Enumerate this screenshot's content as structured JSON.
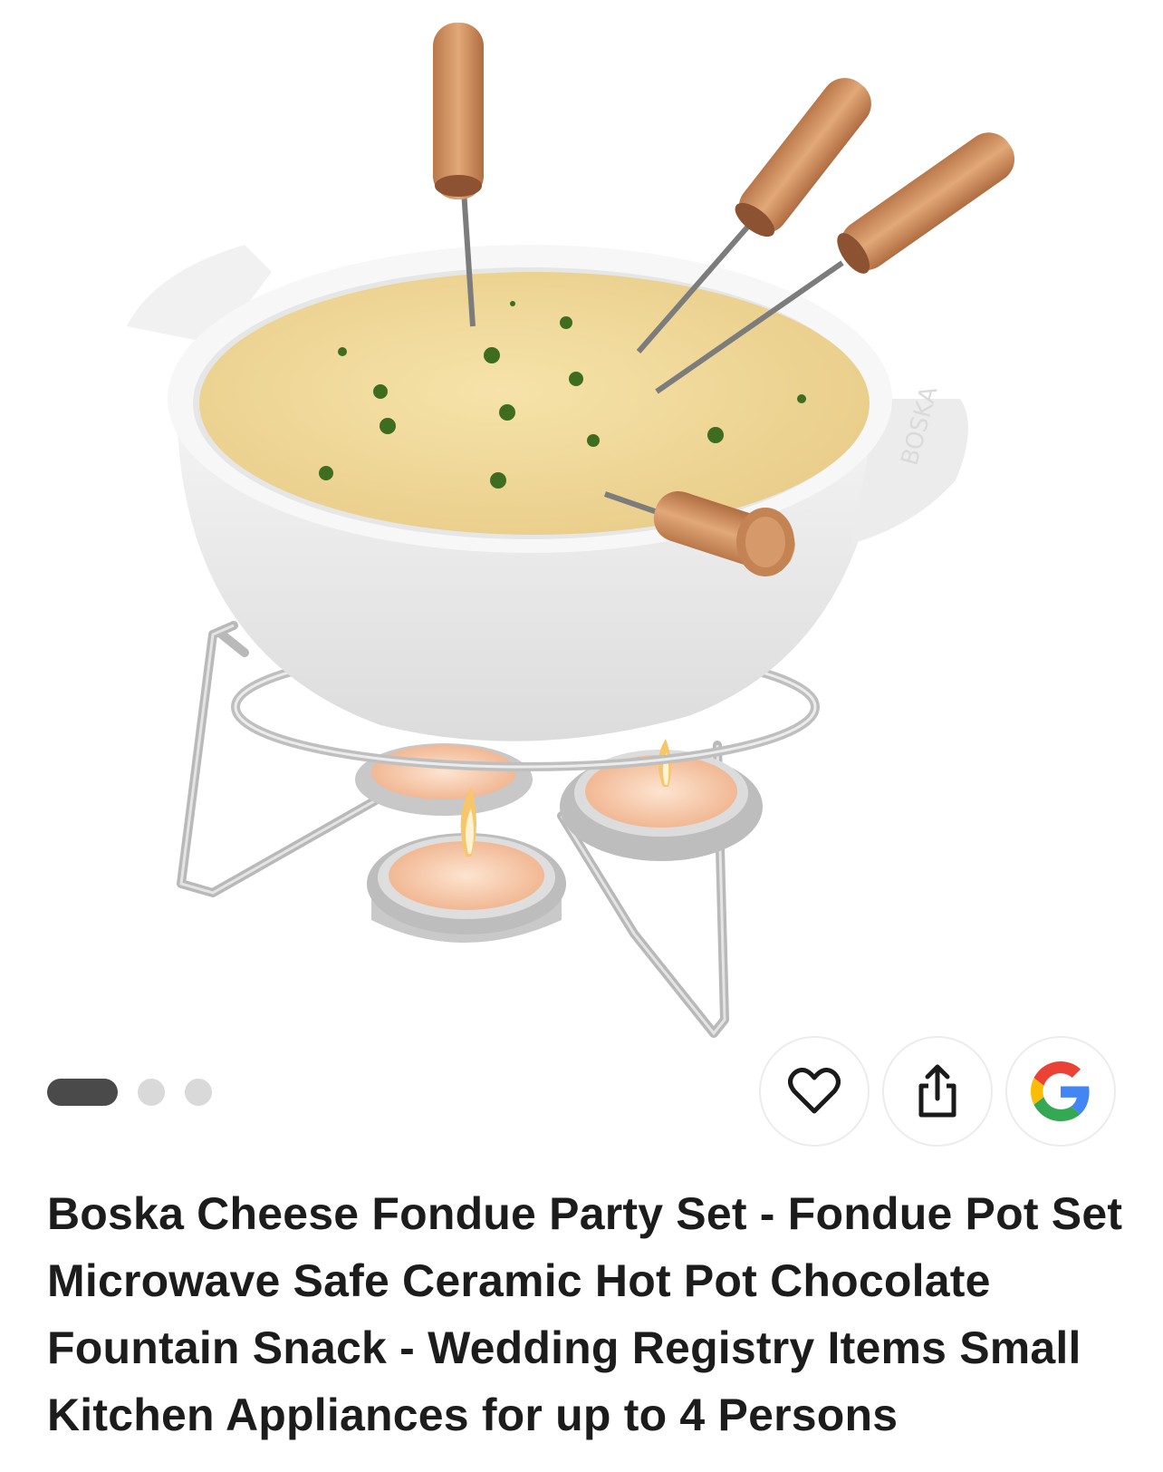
{
  "product": {
    "title": "Boska Cheese Fondue Party Set - Fondue Pot Set Microwave Safe Ceramic Hot Pot Chocolate Fountain Snack - Wedding Registry Items Small Kitchen Appliances for up to 4 Persons",
    "image_engraving": "BOSKA"
  },
  "gallery": {
    "page_count": 3,
    "active_page": 1
  },
  "actions": [
    {
      "name": "favorite",
      "icon": "heart-outline-icon"
    },
    {
      "name": "share",
      "icon": "share-icon"
    },
    {
      "name": "google-search",
      "icon": "google-g-icon"
    }
  ],
  "colors": {
    "pager_active": "#4a4a4a",
    "pager_inactive": "#d9d9d9",
    "title_text": "#1c1c1c",
    "google_blue": "#4285F4",
    "google_red": "#EA4335",
    "google_yellow": "#FBBC05",
    "google_green": "#34A853"
  }
}
